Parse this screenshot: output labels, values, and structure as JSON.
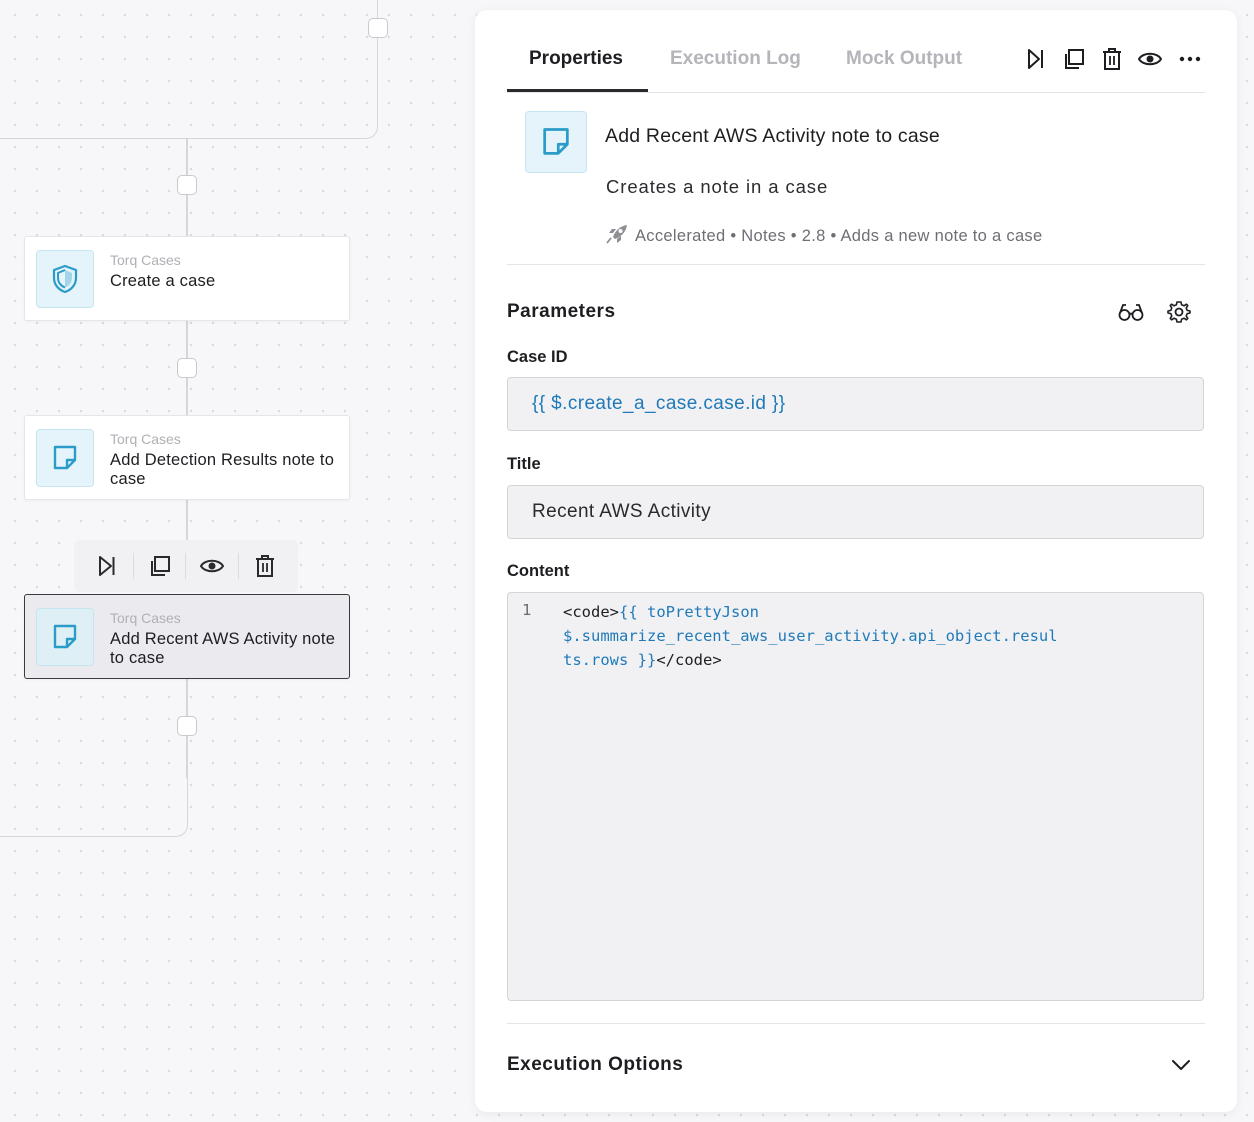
{
  "canvas": {
    "nodes": [
      {
        "provider": "Torq Cases",
        "name": "Create a case",
        "icon": "shield-icon"
      },
      {
        "provider": "Torq Cases",
        "name": "Add Detection Results note to case",
        "icon": "note-icon"
      },
      {
        "provider": "Torq Cases",
        "name": "Add Recent AWS Activity note to case",
        "icon": "note-icon",
        "selected": true
      }
    ],
    "node_toolbar": [
      "run-step",
      "duplicate",
      "preview",
      "delete"
    ]
  },
  "panel": {
    "tabs": [
      {
        "label": "Properties",
        "active": true
      },
      {
        "label": "Execution Log",
        "active": false
      },
      {
        "label": "Mock Output",
        "active": false
      }
    ],
    "step": {
      "title": "Add Recent AWS Activity note to case",
      "description": "Creates a note in a case",
      "meta": "Accelerated • Notes • 2.8 • Adds a new note to a case"
    },
    "parameters": {
      "title": "Parameters",
      "fields": {
        "case_id": {
          "label": "Case ID",
          "value": "{{ $.create_a_case.case.id }}"
        },
        "title": {
          "label": "Title",
          "value": "Recent AWS Activity"
        },
        "content": {
          "label": "Content",
          "line_number": "1",
          "seg1": "<code>",
          "seg2": "{{ toPrettyJson",
          "seg3": "$.summarize_recent_aws_user_activity.api_object.resul",
          "seg4": "ts.rows }}",
          "seg5": "</code>"
        }
      }
    },
    "execution_options": {
      "title": "Execution Options"
    }
  },
  "colors": {
    "accent_blue": "#1f7ab8",
    "icon_bg": "#e4f4fa"
  }
}
